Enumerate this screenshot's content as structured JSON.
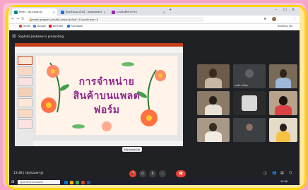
{
  "browser": {
    "tabs": [
      {
        "label": "Meet - tbj-kzow-tjy",
        "color": "#00897b"
      },
      {
        "label": "ห้องเรียนออนไลน์ - powerpoint",
        "color": "#1a73e8"
      },
      {
        "label": "แบบบันทึกกิจกรรม",
        "color": "#9c27b0"
      }
    ],
    "url": "meet.google.com/tbj-kzow-tjy?pli=1&authuser=0",
    "bookmarks": [
      "Gmail",
      "Google",
      "YouTube",
      "Facebook"
    ],
    "reading_list": "Reading list"
  },
  "meet": {
    "presenter": "Sophida Jankaew is presenting",
    "slide_title_lines": [
      "การจำหน่าย",
      "สินค้าบนแพลต",
      "ฟอร์ม"
    ],
    "caption": "tbj-kzow-tjy",
    "time": "13:48",
    "meeting_code": "tbj-kzow-tjy",
    "participant_labels": [
      "",
      "กนต์ธร ศรีสุข",
      "",
      "",
      "",
      "",
      "",
      "",
      ""
    ]
  },
  "taskbar": {
    "search_placeholder": "Type here to search",
    "clock": "13:48"
  },
  "colors": {
    "accent": "#ffd400",
    "end_call": "#ea4335",
    "slide_text": "#8e2a8c"
  }
}
